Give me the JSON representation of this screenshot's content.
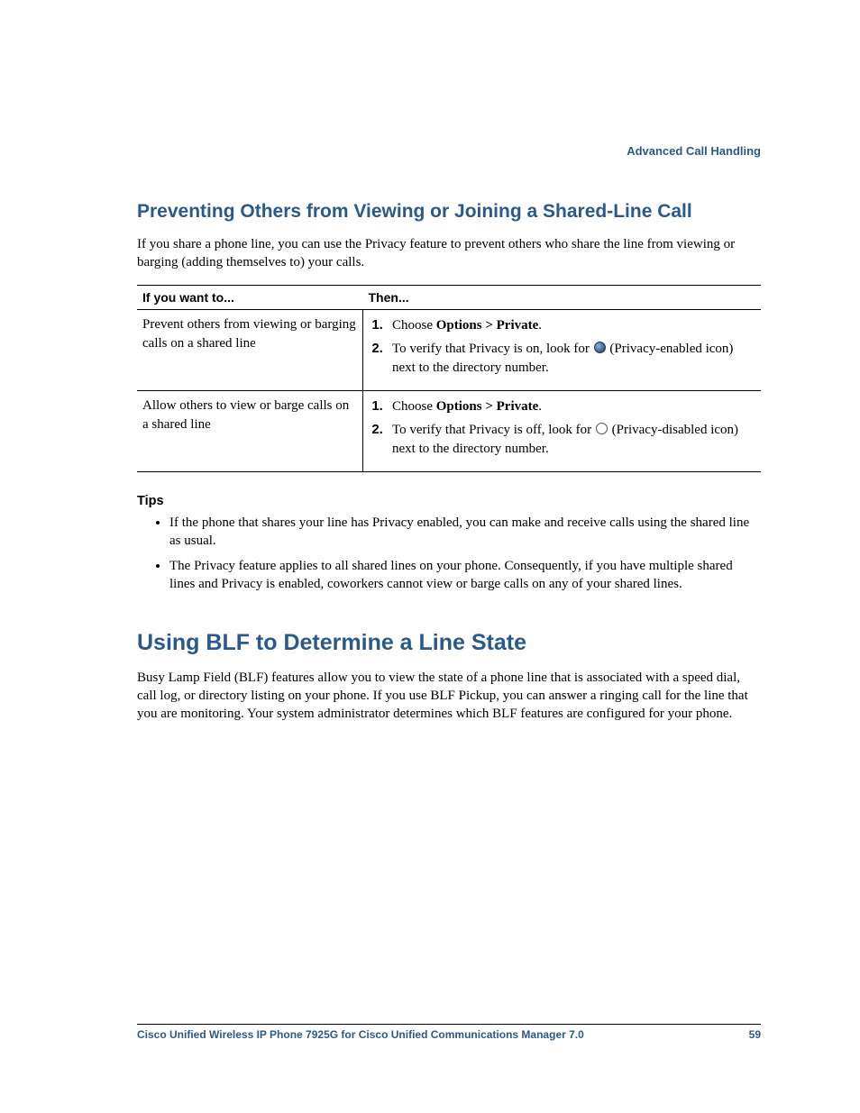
{
  "header": {
    "section": "Advanced Call Handling"
  },
  "subheading1": "Preventing Others from Viewing or Joining a Shared-Line Call",
  "intro1": "If you share a phone line, you can use the Privacy feature to prevent others who share the line from viewing or barging (adding themselves to) your calls.",
  "table": {
    "col1": "If you want to...",
    "col2": "Then...",
    "row1": {
      "left": "Prevent others from viewing or barging calls on a shared line",
      "step1_a": "Choose ",
      "step1_b": "Options > Private",
      "step1_c": ".",
      "step2_a": "To verify that Privacy is on, look for ",
      "step2_b": " (Privacy-enabled icon) next to the directory number."
    },
    "row2": {
      "left": "Allow others to view or barge calls on a shared line",
      "step1_a": "Choose ",
      "step1_b": "Options > Private",
      "step1_c": ".",
      "step2_a": "To verify that Privacy is off, look for ",
      "step2_b": " (Privacy-disabled icon) next to the directory number."
    }
  },
  "tips": {
    "label": "Tips",
    "item1": "If the phone that shares your line has Privacy enabled, you can make and receive calls using the shared line as usual.",
    "item2": "The Privacy feature applies to all shared lines on your phone. Consequently, if you have multiple shared lines and Privacy is enabled, coworkers cannot view or barge calls on any of your shared lines."
  },
  "heading2": "Using BLF to Determine a Line State",
  "intro2": "Busy Lamp Field (BLF) features allow you to view the state of a phone line that is associated with a speed dial, call log, or directory listing on your phone. If you use BLF Pickup, you can answer a ringing call for the line that you are monitoring. Your system administrator determines which BLF features are configured for your phone.",
  "footer": {
    "title": "Cisco Unified Wireless IP Phone 7925G for Cisco Unified Communications Manager 7.0",
    "page": "59"
  }
}
